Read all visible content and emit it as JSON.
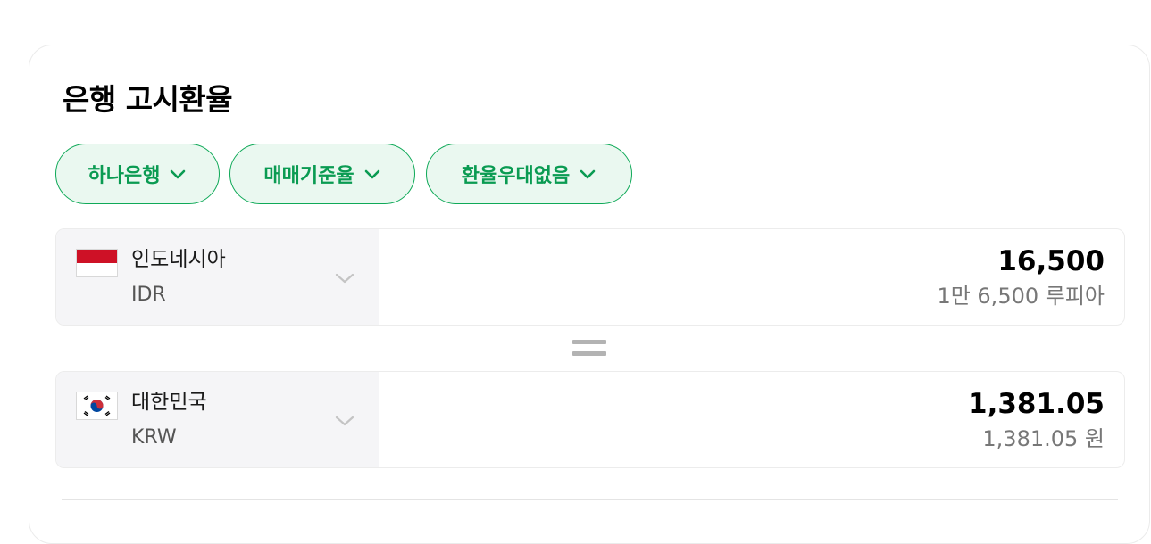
{
  "widget": {
    "title": "은행 고시환율"
  },
  "filters": [
    {
      "label": "하나은행",
      "icon": "chevron-down-icon"
    },
    {
      "label": "매매기준율",
      "icon": "chevron-down-icon"
    },
    {
      "label": "환율우대없음",
      "icon": "chevron-down-icon"
    }
  ],
  "colors": {
    "accent": "#0a9b52",
    "pill_bg": "#eaf8f0",
    "select_bg": "#f5f5f7"
  },
  "from_currency": {
    "flag": "indonesia-flag-icon",
    "name": "인도네시아",
    "code": "IDR",
    "amount": "16,500",
    "amount_words": "1만 6,500 루피아"
  },
  "equals_icon": "equals-icon",
  "to_currency": {
    "flag": "south-korea-flag-icon",
    "name": "대한민국",
    "code": "KRW",
    "amount": "1,381.05",
    "amount_words": "1,381.05 원"
  }
}
